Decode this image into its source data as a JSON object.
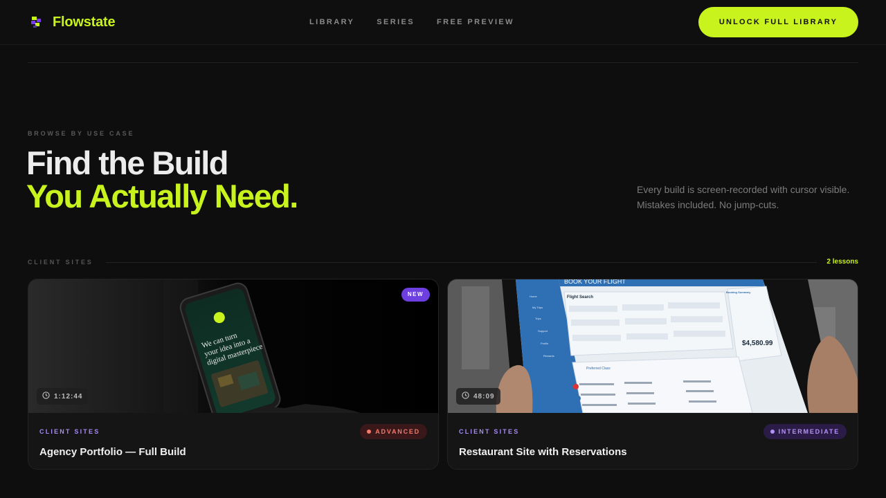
{
  "brand": {
    "name": "Flowstate",
    "accent": "#c8f31d"
  },
  "nav": {
    "items": [
      "LIBRARY",
      "SERIES",
      "FREE PREVIEW"
    ]
  },
  "cta": {
    "label": "UNLOCK FULL LIBRARY"
  },
  "hero": {
    "eyebrow": "BROWSE BY USE CASE",
    "line1": "Find the Build",
    "line2": "You Actually Need.",
    "description": "Every build is screen-recorded with cursor visible. Mistakes included. No jump-cuts."
  },
  "section": {
    "label": "CLIENT SITES",
    "count": "2 lessons"
  },
  "cards": [
    {
      "category": "CLIENT SITES",
      "title": "Agency Portfolio — Full Build",
      "level": "ADVANCED",
      "duration": "1:12:44",
      "badge": "NEW",
      "phone_text": "We can turn your idea into a digital masterpiece"
    },
    {
      "category": "CLIENT SITES",
      "title": "Restaurant Site with Reservations",
      "level": "INTERMEDIATE",
      "duration": "48:09",
      "screen": {
        "header": "BOOK YOUR FLIGHT",
        "panel_title": "Flight Search",
        "side_menu": [
          "Home",
          "My Trips",
          "Trips",
          "Support",
          "Profile",
          "Rewards"
        ],
        "price": "$4,580.99",
        "summary_title": "Booking Summary",
        "tab": "Preferred Class"
      }
    }
  ],
  "colors": {
    "accent": "#c8f31d",
    "purple": "#a78bfa",
    "advanced": "#f47a6c",
    "new_badge": "#6d3fe0"
  }
}
